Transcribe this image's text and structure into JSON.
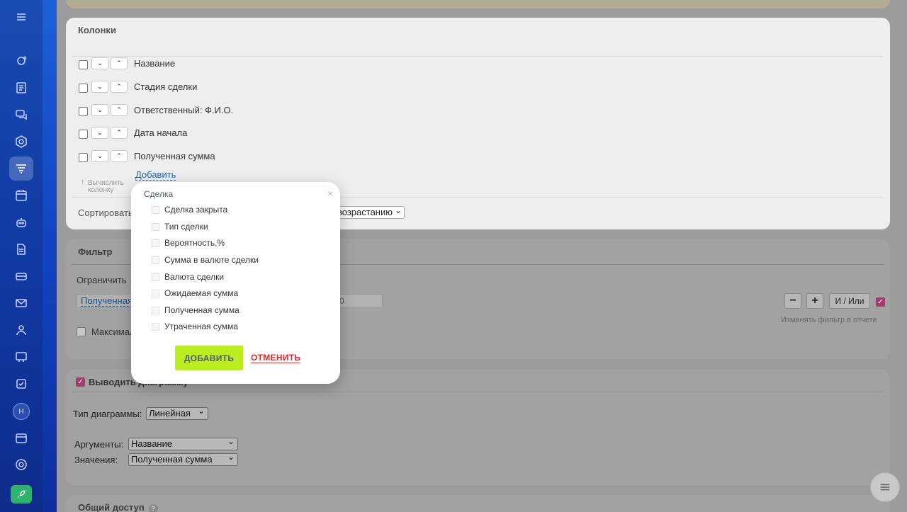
{
  "columns_panel": {
    "title": "Колонки",
    "rows": [
      {
        "label": "Название"
      },
      {
        "label": "Стадия сделки"
      },
      {
        "label": "Ответственный: Ф.И.О."
      },
      {
        "label": "Дата начала"
      },
      {
        "label": "Полученная сумма"
      }
    ],
    "calc_hint_line1": "Вычислить",
    "calc_hint_line2": "колонку",
    "add_link": "Добавить",
    "sort_label": "Сортировать",
    "sort_order": "возрастанию"
  },
  "filter_panel": {
    "title": "Фильтр",
    "limit_label": "Ограничить",
    "field_value": "Полученная",
    "value_partial": "0",
    "max_label": "Максимал",
    "and_or_button": "И / Или",
    "change_hint": "Изменять фильтр в отчете"
  },
  "diagram_panel": {
    "title": "Выводить диаграмму",
    "type_label": "Тип диаграммы:",
    "type_value": "Линейная",
    "args_label": "Аргументы:",
    "args_value": "Название",
    "values_label": "Значения:",
    "values_value": "Полученная сумма"
  },
  "share_panel": {
    "title": "Общий доступ",
    "help": "?"
  },
  "popup": {
    "title": "Сделка",
    "close": "×",
    "items": [
      "Сделка закрыта",
      "Тип сделки",
      "Вероятность,%",
      "Сумма в валюте сделки",
      "Валюта сделки",
      "Ожидаемая сумма",
      "Полученная сумма",
      "Утраченная сумма"
    ],
    "add_button": "ДОБАВИТЬ",
    "cancel_button": "ОТМЕНИТЬ"
  },
  "sidebar": {
    "avatar_initial": "Н"
  },
  "colors": {
    "accent_green": "#bbed21",
    "cancel_red": "#ee2222",
    "link_blue": "#2067b0",
    "sidebar_blue": "#1e5fd6"
  }
}
